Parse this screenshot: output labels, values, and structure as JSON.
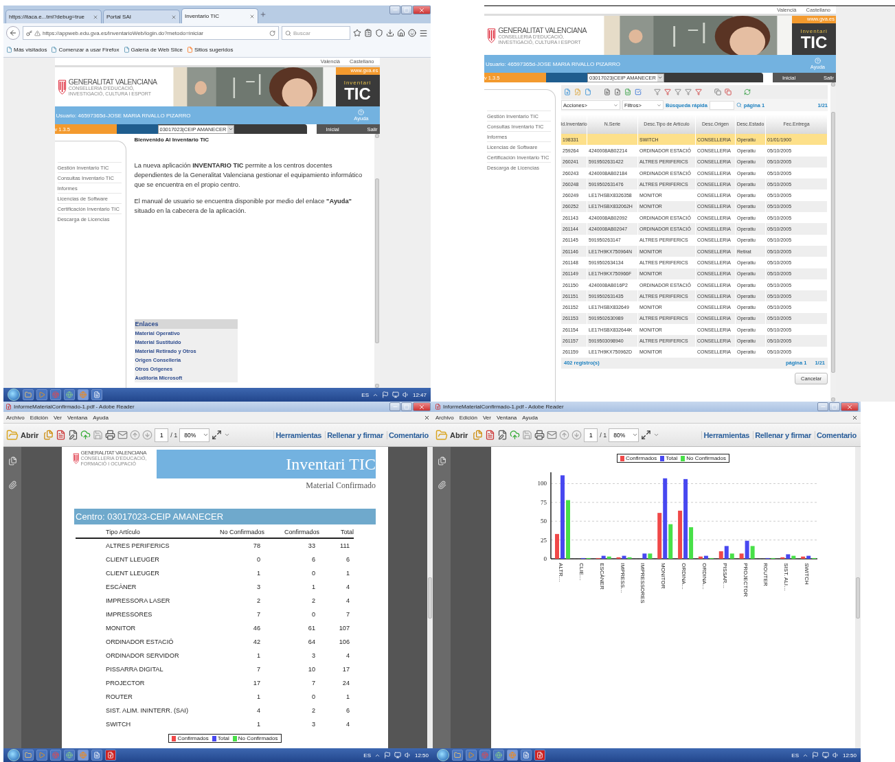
{
  "browser_window": {
    "tabs": [
      {
        "label": "https://itaca.e...tml?debug=true",
        "selected": false
      },
      {
        "label": "Portal SAI",
        "selected": false
      },
      {
        "label": "Inventario TIC",
        "selected": true
      }
    ],
    "url": "https://appweb.edu.gva.es/InventarioWeb/login.do?metodo=iniciar",
    "search_placeholder": "Buscar",
    "bookmarks": [
      "Más visitados",
      "Comenzar a usar Firefox",
      "Galería de Web Slice",
      "Sitios sugeridos"
    ],
    "page": {
      "lang_links": [
        "Valencià",
        "Castellano"
      ],
      "logo_title": "GENERALITAT VALENCIANA",
      "logo_subtitle": "CONSELLERIA D'EDUCACIÓ, INVESTIGACIÓ, CULTURA I ESPORT",
      "site_link": "www.gva.es",
      "brand_top": "Inventari",
      "brand_bottom": "TIC",
      "user": "Usuario: 46597365d-JOSE MARIA RIVALLO PIZARRO",
      "help": "Ayuda",
      "version": "v 1.3.5",
      "center_select": "03017023|CEIP AMANECER",
      "nav": [
        "Inicial",
        "Salir"
      ],
      "sidebar": [
        "Gestión Inventario TIC",
        "Consultas Inventario TIC",
        "Informes",
        "Licencias de Software",
        "Certificación Inventario TIC",
        "Descarga de Licencias"
      ],
      "welcome_title": "Bienvenido Al Inventario TIC",
      "paragraphs": [
        "La nueva aplicación **INVENTARIO TIC** permite a los centros docentes dependientes de la Generalitat Valenciana gestionar el equipamiento informático que se encuentra en el propio centro.",
        "El manual de usuario se encuentra disponible por medio del enlace **\"Ayuda\"** situado en la cabecera de la aplicación."
      ],
      "links_title": "Enlaces",
      "links": [
        "Material Operativo",
        "Material Sustituido",
        "Material Retirado y Otros",
        "Origen Conselleria",
        "Otros Origenes",
        "Auditoria Microsoft"
      ]
    }
  },
  "taskbar_1": {
    "lang": "ES",
    "time": "12:47"
  },
  "inventory_list": {
    "page": {
      "lang_links": [
        "Valencià",
        "Castellano"
      ],
      "logo_title": "GENERALITAT VALENCIANA",
      "logo_subtitle": "CONSELLERIA D'EDUCACIÓ, INVESTIGACIÓ, CULTURA I ESPORT",
      "site_link": "www.gva.es",
      "brand_top": "Inventari",
      "brand_bottom": "TIC",
      "user": "Usuario: 46597365d-JOSE MARIA RIVALLO PIZARRO",
      "help": "Ayuda",
      "version": "v 1.3.5",
      "center_select": "03017023|CEIP AMANECER",
      "nav": [
        "Inicial",
        "Salir"
      ],
      "sidebar": [
        "Gestión Inventario TIC",
        "Consultas Inventario TIC",
        "Informes",
        "Licencias de Software",
        "Certificación Inventario TIC",
        "Descarga de Licencias"
      ]
    },
    "actions": "Acciones>",
    "filters": "Filtros>",
    "quick_search": "Búsqueda rápida",
    "page_label": "página 1",
    "pages": "1/21",
    "columns": [
      "Id.Inventario",
      "N.Serie",
      "Desc.Tipo de Artículo",
      "Desc.Origen",
      "Desc.Estado",
      "Fec.Entrega"
    ],
    "rows": [
      {
        "id": "198331",
        "type": "SWITCH",
        "origin": "CONSELLERIA",
        "state": "Operatiu",
        "date": "01/01/1900",
        "selected": true
      },
      {
        "id": "259264",
        "serial": "4240008AB02214",
        "type": "ORDINADOR ESTACIÓ",
        "origin": "CONSELLERIA",
        "state": "Operatiu",
        "date": "05/10/2005",
        "selected": false
      },
      {
        "id": "260241",
        "serial": "5919502631422",
        "type": "ALTRES PERIFERICS",
        "origin": "CONSELLERIA",
        "state": "Operatiu",
        "date": "05/10/2005",
        "selected": false
      },
      {
        "id": "260243",
        "serial": "4240008AB02184",
        "type": "ORDINADOR ESTACIÓ",
        "origin": "CONSELLERIA",
        "state": "Operatiu",
        "date": "05/10/2005",
        "selected": false
      },
      {
        "id": "260248",
        "serial": "5919502631476",
        "type": "ALTRES PERIFERICS",
        "origin": "CONSELLERIA",
        "state": "Operatiu",
        "date": "05/10/2005",
        "selected": false
      },
      {
        "id": "260249",
        "serial": "LE17HSBX8326358",
        "type": "MONITOR",
        "origin": "CONSELLERIA",
        "state": "Operatiu",
        "date": "05/10/2005",
        "selected": false
      },
      {
        "id": "260252",
        "serial": "LE17HSBX832062H",
        "type": "MONITOR",
        "origin": "CONSELLERIA",
        "state": "Operatiu",
        "date": "05/10/2005",
        "selected": false
      },
      {
        "id": "261143",
        "serial": "4240008AB02092",
        "type": "ORDINADOR ESTACIÓ",
        "origin": "CONSELLERIA",
        "state": "Operatiu",
        "date": "05/10/2005",
        "selected": false
      },
      {
        "id": "261144",
        "serial": "4240008AB02047",
        "type": "ORDINADOR ESTACIÓ",
        "origin": "CONSELLERIA",
        "state": "Operatiu",
        "date": "05/10/2005",
        "selected": false
      },
      {
        "id": "261145",
        "serial": "591950263147",
        "type": "ALTRES PERIFERICS",
        "origin": "CONSELLERIA",
        "state": "Operatiu",
        "date": "05/10/2005",
        "selected": false
      },
      {
        "id": "261146",
        "serial": "LE17H9KX750964N",
        "type": "MONITOR",
        "origin": "CONSELLERIA",
        "state": "Retirat",
        "date": "05/10/2005",
        "selected": false
      },
      {
        "id": "261148",
        "serial": "5919502634134",
        "type": "ALTRES PERIFERICS",
        "origin": "CONSELLERIA",
        "state": "Operatiu",
        "date": "05/10/2005",
        "selected": false
      },
      {
        "id": "261149",
        "serial": "LE17H9KX750966F",
        "type": "MONITOR",
        "origin": "CONSELLERIA",
        "state": "Operatiu",
        "date": "05/10/2005",
        "selected": false
      },
      {
        "id": "261150",
        "serial": "4240008AB016P2",
        "type": "ORDINADOR ESTACIÓ",
        "origin": "CONSELLERIA",
        "state": "Operatiu",
        "date": "05/10/2005",
        "selected": false
      },
      {
        "id": "261151",
        "serial": "5919502631435",
        "type": "ALTRES PERIFERICS",
        "origin": "CONSELLERIA",
        "state": "Operatiu",
        "date": "05/10/2005",
        "selected": false
      },
      {
        "id": "261152",
        "serial": "LE17HSBX832649",
        "type": "MONITOR",
        "origin": "CONSELLERIA",
        "state": "Operatiu",
        "date": "05/10/2005",
        "selected": false
      },
      {
        "id": "261153",
        "serial": "5919502630989",
        "type": "ALTRES PERIFERICS",
        "origin": "CONSELLERIA",
        "state": "Operatiu",
        "date": "05/10/2005",
        "selected": false
      },
      {
        "id": "261154",
        "serial": "LE17HSBX832644K",
        "type": "MONITOR",
        "origin": "CONSELLERIA",
        "state": "Operatiu",
        "date": "05/10/2005",
        "selected": false
      },
      {
        "id": "261157",
        "serial": "5919503098940",
        "type": "ALTRES PERIFERICS",
        "origin": "CONSELLERIA",
        "state": "Operatiu",
        "date": "05/10/2005",
        "selected": false
      },
      {
        "id": "261159",
        "serial": "LE17H9KX750962D",
        "type": "MONITOR",
        "origin": "CONSELLERIA",
        "state": "Operatiu",
        "date": "05/10/2005",
        "selected": false
      }
    ],
    "record_count": "402 registro(s)",
    "footer_page_label": "página 1",
    "footer_pages": "1/21",
    "cancel": "Cancelar"
  },
  "pdf_table_window": {
    "title": "InformeMaterialConfirmado-1.pdf - Adobe Reader",
    "menu": [
      "Archivo",
      "Edición",
      "Ver",
      "Ventana",
      "Ayuda"
    ],
    "toolbar": {
      "open": "Abrir",
      "page": "1",
      "page_total": "/ 1",
      "zoom": "80%",
      "tools": [
        "Herramientas",
        "Rellenar y firmar",
        "Comentario"
      ]
    },
    "report": {
      "logo_title": "GENERALITAT VALENCIANA",
      "logo_subtitle": "CONSELLERIA D'EDUCACIÓ, FORMACIÓ I OCUPACIÓ",
      "title": "Inventari TIC",
      "subtitle": "Material Confirmado",
      "center": "Centro: 03017023-CEIP AMANECER",
      "columns": [
        "Tipo Artículo",
        "No Confirmados",
        "Confirmados",
        "Total"
      ],
      "rows": [
        [
          "ALTRES PERIFERICS",
          "78",
          "33",
          "111"
        ],
        [
          "CLIENT LLEUGER",
          "0",
          "6",
          "6"
        ],
        [
          "CLIENT LLEUGER",
          "1",
          "0",
          "1"
        ],
        [
          "ESCÀNER",
          "3",
          "1",
          "4"
        ],
        [
          "IMPRESSORA LASER",
          "2",
          "2",
          "4"
        ],
        [
          "IMPRESSORES",
          "7",
          "0",
          "7"
        ],
        [
          "MONITOR",
          "46",
          "61",
          "107"
        ],
        [
          "ORDINADOR ESTACIÓ",
          "42",
          "64",
          "106"
        ],
        [
          "ORDINADOR SERVIDOR",
          "1",
          "3",
          "4"
        ],
        [
          "PISSARRA DIGITAL",
          "7",
          "10",
          "17"
        ],
        [
          "PROJECTOR",
          "17",
          "7",
          "24"
        ],
        [
          "ROUTER",
          "1",
          "0",
          "1"
        ],
        [
          "SIST. ALIM. ININTERR. (SAI)",
          "4",
          "2",
          "6"
        ],
        [
          "SWITCH",
          "1",
          "3",
          "4"
        ]
      ],
      "legend": [
        {
          "label": "Confirmados",
          "color": "#f04848"
        },
        {
          "label": "Total",
          "color": "#4848f0"
        },
        {
          "label": "No Confirmados",
          "color": "#48e048"
        }
      ]
    }
  },
  "taskbar_2": {
    "lang": "ES",
    "time": "12:50"
  },
  "pdf_chart_window": {
    "title": "InformeMaterialConfirmado-1.pdf - Adobe Reader",
    "menu": [
      "Archivo",
      "Edición",
      "Ver",
      "Ventana",
      "Ayuda"
    ],
    "toolbar": {
      "open": "Abrir",
      "page": "1",
      "page_total": "/ 1",
      "zoom": "80%",
      "tools": [
        "Herramientas",
        "Rellenar y firmar",
        "Comentario"
      ]
    },
    "chart_data": {
      "type": "bar",
      "categories": [
        "ALTR…",
        "CLIE…",
        "ESCÀNER",
        "IMPRESS…",
        "IMPRESSORES",
        "MONITOR",
        "ORDINA…",
        "ORDINA…",
        "PISSAR…",
        "PROJECTOR",
        "ROUTER",
        "SIST. ALI…",
        "SWITCH"
      ],
      "series": [
        {
          "name": "Confirmados",
          "color": "#f04848",
          "values": [
            33,
            0,
            1,
            2,
            0,
            61,
            64,
            3,
            10,
            7,
            0,
            2,
            3
          ]
        },
        {
          "name": "Total",
          "color": "#4848f0",
          "values": [
            111,
            1,
            4,
            4,
            7,
            107,
            106,
            4,
            17,
            24,
            1,
            6,
            4
          ]
        },
        {
          "name": "No Confirmados",
          "color": "#48e048",
          "values": [
            78,
            1,
            3,
            2,
            7,
            46,
            42,
            1,
            7,
            17,
            1,
            4,
            1
          ]
        }
      ],
      "ylim": [
        0,
        115
      ],
      "yticks": [
        0,
        25,
        50,
        75,
        100
      ],
      "grid": true,
      "legend": "top"
    }
  },
  "taskbar_3": {
    "lang": "ES",
    "time": "12:50"
  }
}
